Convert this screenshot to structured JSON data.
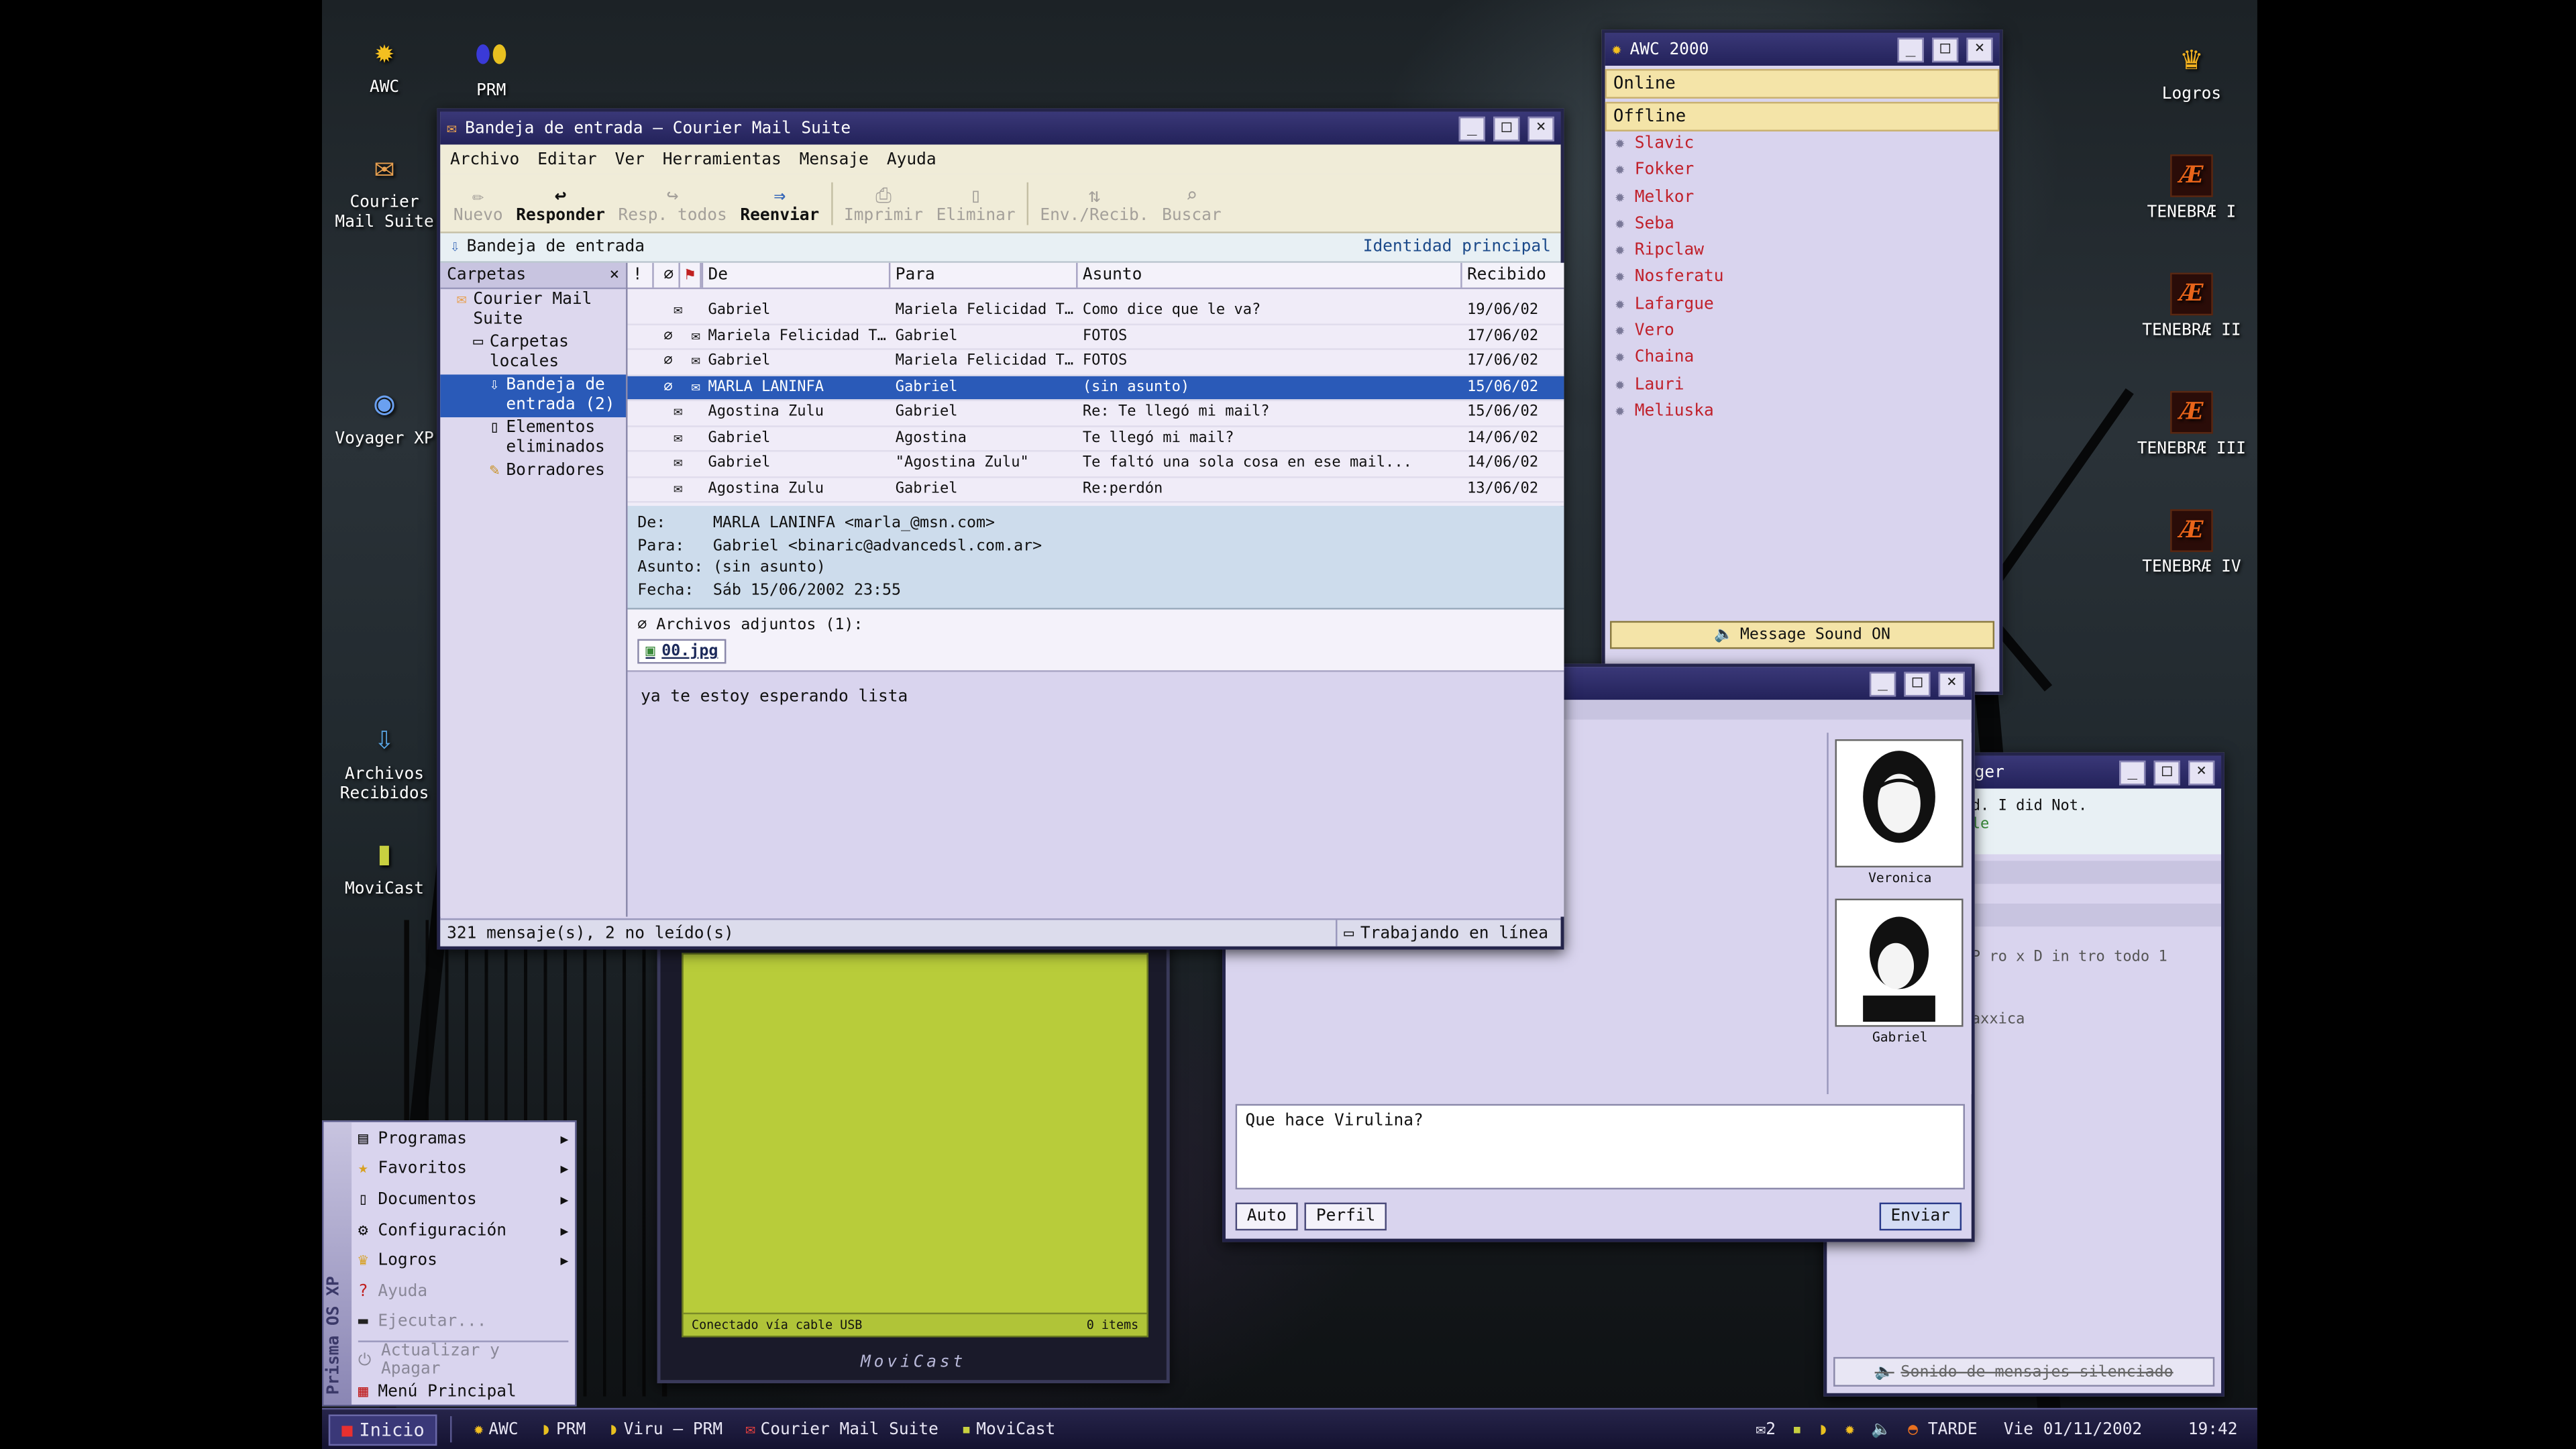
{
  "desktop": {
    "icons": {
      "awc": "AWC",
      "prm": "PRM",
      "courier": "Courier Mail Suite",
      "voyager": "Voyager XP",
      "archivos": "Archivos Recibidos",
      "movicast": "MoviCast",
      "logros": "Logros",
      "t1": "TENEBRÆ I",
      "t2": "TENEBRÆ II",
      "t3": "TENEBRÆ III",
      "t4": "TENEBRÆ IV"
    }
  },
  "mail": {
    "title": "Bandeja de entrada – Courier Mail Suite",
    "menu": [
      "Archivo",
      "Editar",
      "Ver",
      "Herramientas",
      "Mensaje",
      "Ayuda"
    ],
    "toolbar": [
      "Nuevo",
      "Responder",
      "Resp. todos",
      "Reenviar",
      "Imprimir",
      "Eliminar",
      "Env./Recib.",
      "Buscar"
    ],
    "folder_title": "Bandeja de entrada",
    "identity": "Identidad principal",
    "folders_header": "Carpetas",
    "folders": [
      "Courier Mail Suite",
      "Carpetas locales",
      "Bandeja de entrada (2)",
      "Elementos eliminados",
      "Borradores"
    ],
    "columns": {
      "flag": "!",
      "from": "De",
      "to": "Para",
      "subject": "Asunto",
      "received": "Recibido"
    },
    "rows": [
      {
        "from": "Gabriel",
        "to": "Mariela Felicidad T…",
        "subject": "Como dice que le va?",
        "date": "19/06/02"
      },
      {
        "from": "Mariela Felicidad T…",
        "to": "Gabriel",
        "subject": "FOTOS",
        "date": "17/06/02"
      },
      {
        "from": "Gabriel",
        "to": "Mariela Felicidad T…",
        "subject": "FOTOS",
        "date": "17/06/02"
      },
      {
        "from": "MARLA LANINFA",
        "to": "Gabriel",
        "subject": "(sin asunto)",
        "date": "15/06/02"
      },
      {
        "from": "Agostina Zulu",
        "to": "Gabriel",
        "subject": "Re: Te llegó mi mail?",
        "date": "15/06/02"
      },
      {
        "from": "Gabriel",
        "to": "Agostina",
        "subject": "Te llegó mi mail?",
        "date": "14/06/02"
      },
      {
        "from": "Gabriel",
        "to": "\"Agostina Zulu\"",
        "subject": "Te faltó una sola cosa en ese mail...",
        "date": "14/06/02"
      },
      {
        "from": "Agostina Zulu",
        "to": "Gabriel",
        "subject": "Re:perdón",
        "date": "13/06/02"
      }
    ],
    "preview": {
      "from_label": "De:",
      "from": "MARLA LANINFA <marla_@msn.com>",
      "to_label": "Para:",
      "to": "Gabriel <binaric@advancedsl.com.ar>",
      "subject_label": "Asunto:",
      "subject": "(sin asunto)",
      "date_label": "Fecha:",
      "date": "Sáb 15/06/2002 23:55",
      "attachments_label": "Archivos adjuntos (1):",
      "attachment": "00.jpg",
      "body": "ya te estoy esperando lista"
    },
    "status": "321 mensaje(s), 2 no leído(s)",
    "online_status": "Trabajando en línea"
  },
  "awc": {
    "title": "AWC 2000",
    "online": "Online",
    "offline": "Offline",
    "contacts": [
      "Slavic",
      "Fokker",
      "Melkor",
      "Seba",
      "Ripclaw",
      "Nosferatu",
      "Lafargue",
      "Vero",
      "Chaina",
      "Lauri",
      "Meliuska"
    ],
    "sound_button": "Message Sound ON"
  },
  "chat": {
    "avatars": [
      "Veronica",
      "Gabriel"
    ],
    "input": "Que hace Virulina?",
    "auto": "Auto",
    "perfil": "Perfil",
    "send": "Enviar"
  },
  "back": {
    "title_fragment": "ger",
    "line1": "d. I did Not.",
    "line2": "le",
    "line3": "P ro x D in tro todo 1",
    "line4": "axxica",
    "muted": "Sonido de mensajes silenciado"
  },
  "movicast": {
    "status": "Conectado vía cable USB",
    "items": "0 items",
    "brand": "MoviCast"
  },
  "start_menu": {
    "brand": "Prisma OS XP",
    "items": [
      "Programas",
      "Favoritos",
      "Documentos",
      "Configuración",
      "Logros",
      "Ayuda",
      "Ejecutar...",
      "Actualizar y Apagar",
      "Menú Principal"
    ]
  },
  "taskbar": {
    "start": "Inicio",
    "tasks": [
      "AWC",
      "PRM",
      "Viru – PRM",
      "Courier Mail Suite",
      "MoviCast"
    ],
    "mail_count": "✉2",
    "period": "TARDE",
    "date": "Vie 01/11/2002",
    "time": "19:42"
  }
}
